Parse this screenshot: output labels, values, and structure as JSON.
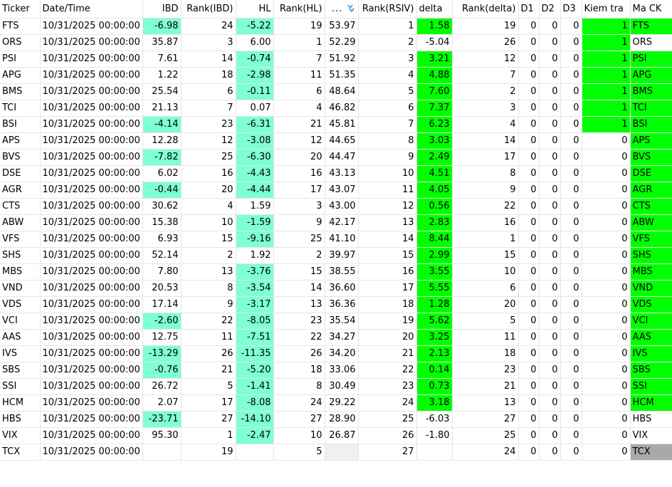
{
  "columns": [
    "Ticker",
    "Date/Time",
    "IBD",
    "Rank(IBD)",
    "HL",
    "Rank(HL)",
    "...",
    "Rank(RSIV)",
    "delta",
    "Rank(delta)",
    "D1",
    "D2",
    "D3",
    "Kiem tra",
    "Ma CK"
  ],
  "icons": {
    "sort": "sort-descending-icon"
  },
  "colors": {
    "teal": "#7fffd4",
    "green": "#00ff00",
    "gray": "#a9a9a9"
  },
  "rows": [
    {
      "ticker": "FTS",
      "date": "10/31/2025 00:00:00",
      "ibd": "-6.98",
      "rank_ibd": "24",
      "hl": "-5.22",
      "rank_hl": "19",
      "rsiv": "53.97",
      "rank_rsiv": "1",
      "delta": "1.58",
      "rank_delta": "19",
      "d1": "0",
      "d2": "0",
      "d3": "0",
      "kiem_tra": "1",
      "ma_ck": "FTS",
      "ibd_hl": true,
      "hl_hl": true,
      "delta_hl": true,
      "kt_hl": true,
      "ck_color": "green"
    },
    {
      "ticker": "ORS",
      "date": "10/31/2025 00:00:00",
      "ibd": "35.87",
      "rank_ibd": "3",
      "hl": "6.00",
      "rank_hl": "1",
      "rsiv": "52.29",
      "rank_rsiv": "2",
      "delta": "-5.04",
      "rank_delta": "26",
      "d1": "0",
      "d2": "0",
      "d3": "0",
      "kiem_tra": "1",
      "ma_ck": "ORS",
      "ibd_hl": false,
      "hl_hl": false,
      "delta_hl": false,
      "kt_hl": true,
      "ck_color": "none"
    },
    {
      "ticker": "PSI",
      "date": "10/31/2025 00:00:00",
      "ibd": "7.61",
      "rank_ibd": "14",
      "hl": "-0.74",
      "rank_hl": "7",
      "rsiv": "51.92",
      "rank_rsiv": "3",
      "delta": "3.21",
      "rank_delta": "12",
      "d1": "0",
      "d2": "0",
      "d3": "0",
      "kiem_tra": "1",
      "ma_ck": "PSI",
      "ibd_hl": false,
      "hl_hl": true,
      "delta_hl": true,
      "kt_hl": true,
      "ck_color": "green"
    },
    {
      "ticker": "APG",
      "date": "10/31/2025 00:00:00",
      "ibd": "1.22",
      "rank_ibd": "18",
      "hl": "-2.98",
      "rank_hl": "11",
      "rsiv": "51.35",
      "rank_rsiv": "4",
      "delta": "4.88",
      "rank_delta": "7",
      "d1": "0",
      "d2": "0",
      "d3": "0",
      "kiem_tra": "1",
      "ma_ck": "APG",
      "ibd_hl": false,
      "hl_hl": true,
      "delta_hl": true,
      "kt_hl": true,
      "ck_color": "green"
    },
    {
      "ticker": "BMS",
      "date": "10/31/2025 00:00:00",
      "ibd": "25.54",
      "rank_ibd": "6",
      "hl": "-0.11",
      "rank_hl": "6",
      "rsiv": "48.64",
      "rank_rsiv": "5",
      "delta": "7.60",
      "rank_delta": "2",
      "d1": "0",
      "d2": "0",
      "d3": "0",
      "kiem_tra": "1",
      "ma_ck": "BMS",
      "ibd_hl": false,
      "hl_hl": true,
      "delta_hl": true,
      "kt_hl": true,
      "ck_color": "green"
    },
    {
      "ticker": "TCI",
      "date": "10/31/2025 00:00:00",
      "ibd": "21.13",
      "rank_ibd": "7",
      "hl": "0.07",
      "rank_hl": "4",
      "rsiv": "46.82",
      "rank_rsiv": "6",
      "delta": "7.37",
      "rank_delta": "3",
      "d1": "0",
      "d2": "0",
      "d3": "0",
      "kiem_tra": "1",
      "ma_ck": "TCI",
      "ibd_hl": false,
      "hl_hl": false,
      "delta_hl": true,
      "kt_hl": true,
      "ck_color": "green"
    },
    {
      "ticker": "BSI",
      "date": "10/31/2025 00:00:00",
      "ibd": "-4.14",
      "rank_ibd": "23",
      "hl": "-6.31",
      "rank_hl": "21",
      "rsiv": "45.81",
      "rank_rsiv": "7",
      "delta": "6.23",
      "rank_delta": "4",
      "d1": "0",
      "d2": "0",
      "d3": "0",
      "kiem_tra": "1",
      "ma_ck": "BSI",
      "ibd_hl": true,
      "hl_hl": true,
      "delta_hl": true,
      "kt_hl": true,
      "ck_color": "green"
    },
    {
      "ticker": "APS",
      "date": "10/31/2025 00:00:00",
      "ibd": "12.28",
      "rank_ibd": "12",
      "hl": "-3.08",
      "rank_hl": "12",
      "rsiv": "44.65",
      "rank_rsiv": "8",
      "delta": "3.03",
      "rank_delta": "14",
      "d1": "0",
      "d2": "0",
      "d3": "0",
      "kiem_tra": "0",
      "ma_ck": "APS",
      "ibd_hl": false,
      "hl_hl": true,
      "delta_hl": true,
      "kt_hl": false,
      "ck_color": "green"
    },
    {
      "ticker": "BVS",
      "date": "10/31/2025 00:00:00",
      "ibd": "-7.82",
      "rank_ibd": "25",
      "hl": "-6.30",
      "rank_hl": "20",
      "rsiv": "44.47",
      "rank_rsiv": "9",
      "delta": "2.49",
      "rank_delta": "17",
      "d1": "0",
      "d2": "0",
      "d3": "0",
      "kiem_tra": "0",
      "ma_ck": "BVS",
      "ibd_hl": true,
      "hl_hl": true,
      "delta_hl": true,
      "kt_hl": false,
      "ck_color": "green"
    },
    {
      "ticker": "DSE",
      "date": "10/31/2025 00:00:00",
      "ibd": "6.02",
      "rank_ibd": "16",
      "hl": "-4.43",
      "rank_hl": "16",
      "rsiv": "43.13",
      "rank_rsiv": "10",
      "delta": "4.51",
      "rank_delta": "8",
      "d1": "0",
      "d2": "0",
      "d3": "0",
      "kiem_tra": "0",
      "ma_ck": "DSE",
      "ibd_hl": false,
      "hl_hl": true,
      "delta_hl": true,
      "kt_hl": false,
      "ck_color": "green"
    },
    {
      "ticker": "AGR",
      "date": "10/31/2025 00:00:00",
      "ibd": "-0.44",
      "rank_ibd": "20",
      "hl": "-4.44",
      "rank_hl": "17",
      "rsiv": "43.07",
      "rank_rsiv": "11",
      "delta": "4.05",
      "rank_delta": "9",
      "d1": "0",
      "d2": "0",
      "d3": "0",
      "kiem_tra": "0",
      "ma_ck": "AGR",
      "ibd_hl": true,
      "hl_hl": true,
      "delta_hl": true,
      "kt_hl": false,
      "ck_color": "green"
    },
    {
      "ticker": "CTS",
      "date": "10/31/2025 00:00:00",
      "ibd": "30.62",
      "rank_ibd": "4",
      "hl": "1.59",
      "rank_hl": "3",
      "rsiv": "43.00",
      "rank_rsiv": "12",
      "delta": "0.56",
      "rank_delta": "22",
      "d1": "0",
      "d2": "0",
      "d3": "0",
      "kiem_tra": "0",
      "ma_ck": "CTS",
      "ibd_hl": false,
      "hl_hl": false,
      "delta_hl": true,
      "kt_hl": false,
      "ck_color": "green"
    },
    {
      "ticker": "ABW",
      "date": "10/31/2025 00:00:00",
      "ibd": "15.38",
      "rank_ibd": "10",
      "hl": "-1.59",
      "rank_hl": "9",
      "rsiv": "42.17",
      "rank_rsiv": "13",
      "delta": "2.83",
      "rank_delta": "16",
      "d1": "0",
      "d2": "0",
      "d3": "0",
      "kiem_tra": "0",
      "ma_ck": "ABW",
      "ibd_hl": false,
      "hl_hl": true,
      "delta_hl": true,
      "kt_hl": false,
      "ck_color": "green"
    },
    {
      "ticker": "VFS",
      "date": "10/31/2025 00:00:00",
      "ibd": "6.93",
      "rank_ibd": "15",
      "hl": "-9.16",
      "rank_hl": "25",
      "rsiv": "41.10",
      "rank_rsiv": "14",
      "delta": "8.44",
      "rank_delta": "1",
      "d1": "0",
      "d2": "0",
      "d3": "0",
      "kiem_tra": "0",
      "ma_ck": "VFS",
      "ibd_hl": false,
      "hl_hl": true,
      "delta_hl": true,
      "kt_hl": false,
      "ck_color": "green"
    },
    {
      "ticker": "SHS",
      "date": "10/31/2025 00:00:00",
      "ibd": "52.14",
      "rank_ibd": "2",
      "hl": "1.92",
      "rank_hl": "2",
      "rsiv": "39.97",
      "rank_rsiv": "15",
      "delta": "2.99",
      "rank_delta": "15",
      "d1": "0",
      "d2": "0",
      "d3": "0",
      "kiem_tra": "0",
      "ma_ck": "SHS",
      "ibd_hl": false,
      "hl_hl": false,
      "delta_hl": true,
      "kt_hl": false,
      "ck_color": "green"
    },
    {
      "ticker": "MBS",
      "date": "10/31/2025 00:00:00",
      "ibd": "7.80",
      "rank_ibd": "13",
      "hl": "-3.76",
      "rank_hl": "15",
      "rsiv": "38.55",
      "rank_rsiv": "16",
      "delta": "3.55",
      "rank_delta": "10",
      "d1": "0",
      "d2": "0",
      "d3": "0",
      "kiem_tra": "0",
      "ma_ck": "MBS",
      "ibd_hl": false,
      "hl_hl": true,
      "delta_hl": true,
      "kt_hl": false,
      "ck_color": "green"
    },
    {
      "ticker": "VND",
      "date": "10/31/2025 00:00:00",
      "ibd": "20.53",
      "rank_ibd": "8",
      "hl": "-3.54",
      "rank_hl": "14",
      "rsiv": "36.60",
      "rank_rsiv": "17",
      "delta": "5.55",
      "rank_delta": "6",
      "d1": "0",
      "d2": "0",
      "d3": "0",
      "kiem_tra": "0",
      "ma_ck": "VND",
      "ibd_hl": false,
      "hl_hl": true,
      "delta_hl": true,
      "kt_hl": false,
      "ck_color": "green"
    },
    {
      "ticker": "VDS",
      "date": "10/31/2025 00:00:00",
      "ibd": "17.14",
      "rank_ibd": "9",
      "hl": "-3.17",
      "rank_hl": "13",
      "rsiv": "36.36",
      "rank_rsiv": "18",
      "delta": "1.28",
      "rank_delta": "20",
      "d1": "0",
      "d2": "0",
      "d3": "0",
      "kiem_tra": "0",
      "ma_ck": "VDS",
      "ibd_hl": false,
      "hl_hl": true,
      "delta_hl": true,
      "kt_hl": false,
      "ck_color": "green"
    },
    {
      "ticker": "VCI",
      "date": "10/31/2025 00:00:00",
      "ibd": "-2.60",
      "rank_ibd": "22",
      "hl": "-8.05",
      "rank_hl": "23",
      "rsiv": "35.54",
      "rank_rsiv": "19",
      "delta": "5.62",
      "rank_delta": "5",
      "d1": "0",
      "d2": "0",
      "d3": "0",
      "kiem_tra": "0",
      "ma_ck": "VCI",
      "ibd_hl": true,
      "hl_hl": true,
      "delta_hl": true,
      "kt_hl": false,
      "ck_color": "green"
    },
    {
      "ticker": "AAS",
      "date": "10/31/2025 00:00:00",
      "ibd": "12.75",
      "rank_ibd": "11",
      "hl": "-7.51",
      "rank_hl": "22",
      "rsiv": "34.27",
      "rank_rsiv": "20",
      "delta": "3.25",
      "rank_delta": "11",
      "d1": "0",
      "d2": "0",
      "d3": "0",
      "kiem_tra": "0",
      "ma_ck": "AAS",
      "ibd_hl": false,
      "hl_hl": true,
      "delta_hl": true,
      "kt_hl": false,
      "ck_color": "green"
    },
    {
      "ticker": "IVS",
      "date": "10/31/2025 00:00:00",
      "ibd": "-13.29",
      "rank_ibd": "26",
      "hl": "-11.35",
      "rank_hl": "26",
      "rsiv": "34.20",
      "rank_rsiv": "21",
      "delta": "2.13",
      "rank_delta": "18",
      "d1": "0",
      "d2": "0",
      "d3": "0",
      "kiem_tra": "0",
      "ma_ck": "IVS",
      "ibd_hl": true,
      "hl_hl": true,
      "delta_hl": true,
      "kt_hl": false,
      "ck_color": "green"
    },
    {
      "ticker": "SBS",
      "date": "10/31/2025 00:00:00",
      "ibd": "-0.76",
      "rank_ibd": "21",
      "hl": "-5.20",
      "rank_hl": "18",
      "rsiv": "33.06",
      "rank_rsiv": "22",
      "delta": "0.14",
      "rank_delta": "23",
      "d1": "0",
      "d2": "0",
      "d3": "0",
      "kiem_tra": "0",
      "ma_ck": "SBS",
      "ibd_hl": true,
      "hl_hl": true,
      "delta_hl": true,
      "kt_hl": false,
      "ck_color": "green"
    },
    {
      "ticker": "SSI",
      "date": "10/31/2025 00:00:00",
      "ibd": "26.72",
      "rank_ibd": "5",
      "hl": "-1.41",
      "rank_hl": "8",
      "rsiv": "30.49",
      "rank_rsiv": "23",
      "delta": "0.73",
      "rank_delta": "21",
      "d1": "0",
      "d2": "0",
      "d3": "0",
      "kiem_tra": "0",
      "ma_ck": "SSI",
      "ibd_hl": false,
      "hl_hl": true,
      "delta_hl": true,
      "kt_hl": false,
      "ck_color": "green"
    },
    {
      "ticker": "HCM",
      "date": "10/31/2025 00:00:00",
      "ibd": "2.07",
      "rank_ibd": "17",
      "hl": "-8.08",
      "rank_hl": "24",
      "rsiv": "29.22",
      "rank_rsiv": "24",
      "delta": "3.18",
      "rank_delta": "13",
      "d1": "0",
      "d2": "0",
      "d3": "0",
      "kiem_tra": "0",
      "ma_ck": "HCM",
      "ibd_hl": false,
      "hl_hl": true,
      "delta_hl": true,
      "kt_hl": false,
      "ck_color": "green"
    },
    {
      "ticker": "HBS",
      "date": "10/31/2025 00:00:00",
      "ibd": "-23.71",
      "rank_ibd": "27",
      "hl": "-14.10",
      "rank_hl": "27",
      "rsiv": "28.90",
      "rank_rsiv": "25",
      "delta": "-6.03",
      "rank_delta": "27",
      "d1": "0",
      "d2": "0",
      "d3": "0",
      "kiem_tra": "0",
      "ma_ck": "HBS",
      "ibd_hl": true,
      "hl_hl": true,
      "delta_hl": false,
      "kt_hl": false,
      "ck_color": "none"
    },
    {
      "ticker": "VIX",
      "date": "10/31/2025 00:00:00",
      "ibd": "95.30",
      "rank_ibd": "1",
      "hl": "-2.47",
      "rank_hl": "10",
      "rsiv": "26.87",
      "rank_rsiv": "26",
      "delta": "-1.80",
      "rank_delta": "25",
      "d1": "0",
      "d2": "0",
      "d3": "0",
      "kiem_tra": "0",
      "ma_ck": "VIX",
      "ibd_hl": false,
      "hl_hl": true,
      "delta_hl": false,
      "kt_hl": false,
      "ck_color": "none"
    },
    {
      "ticker": "TCX",
      "date": "10/31/2025 00:00:00",
      "ibd": "",
      "rank_ibd": "19",
      "hl": "",
      "rank_hl": "5",
      "rsiv": "",
      "rank_rsiv": "27",
      "delta": "",
      "rank_delta": "24",
      "d1": "0",
      "d2": "0",
      "d3": "0",
      "kiem_tra": "0",
      "ma_ck": "TCX",
      "ibd_hl": false,
      "hl_hl": false,
      "delta_hl": false,
      "kt_hl": false,
      "ck_color": "gray",
      "rsiv_empty": true
    }
  ]
}
